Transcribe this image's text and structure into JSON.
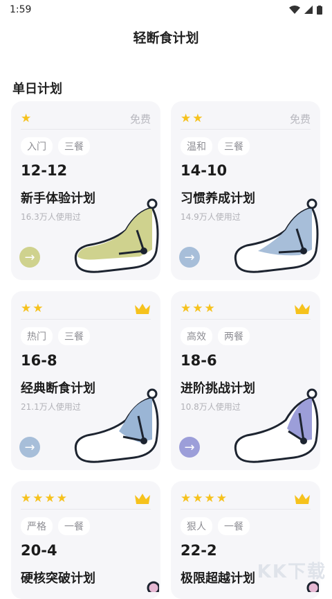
{
  "status": {
    "time": "1:59"
  },
  "header": {
    "title": "轻断食计划"
  },
  "section": {
    "title": "单日计划"
  },
  "cards": [
    {
      "stars": "★",
      "price": "免费",
      "tags": [
        "入门",
        "三餐"
      ],
      "ratio": "12-12",
      "name": "新手体验计划",
      "users": "16.3万人使用过",
      "color": "#cfd28e",
      "arrow_color": "#cfd28e",
      "crown": false
    },
    {
      "stars": "★★",
      "price": "免费",
      "tags": [
        "温和",
        "三餐"
      ],
      "ratio": "14-10",
      "name": "习惯养成计划",
      "users": "14.9万人使用过",
      "color": "#a7bed9",
      "arrow_color": "#a7bed9",
      "crown": false
    },
    {
      "stars": "★★",
      "price": "",
      "tags": [
        "热门",
        "三餐"
      ],
      "ratio": "16-8",
      "name": "经典断食计划",
      "users": "21.1万人使用过",
      "color": "#9ab5d5",
      "arrow_color": "#a7bed9",
      "crown": true
    },
    {
      "stars": "★★★",
      "price": "",
      "tags": [
        "高效",
        "两餐"
      ],
      "ratio": "18-6",
      "name": "进阶挑战计划",
      "users": "10.8万人使用过",
      "color": "#9c9ed9",
      "arrow_color": "#9c9ed9",
      "crown": true
    },
    {
      "stars": "★★★★",
      "price": "",
      "tags": [
        "严格",
        "一餐"
      ],
      "ratio": "20-4",
      "name": "硬核突破计划",
      "users": "",
      "color": "#e6b8d3",
      "arrow_color": "#e6b8d3",
      "crown": true
    },
    {
      "stars": "★★★★",
      "price": "",
      "tags": [
        "狠人",
        "一餐"
      ],
      "ratio": "22-2",
      "name": "极限超越计划",
      "users": "",
      "color": "#e6b8d3",
      "arrow_color": "#e6b8d3",
      "crown": true
    }
  ],
  "watermark": {
    "text": "KK下载"
  }
}
